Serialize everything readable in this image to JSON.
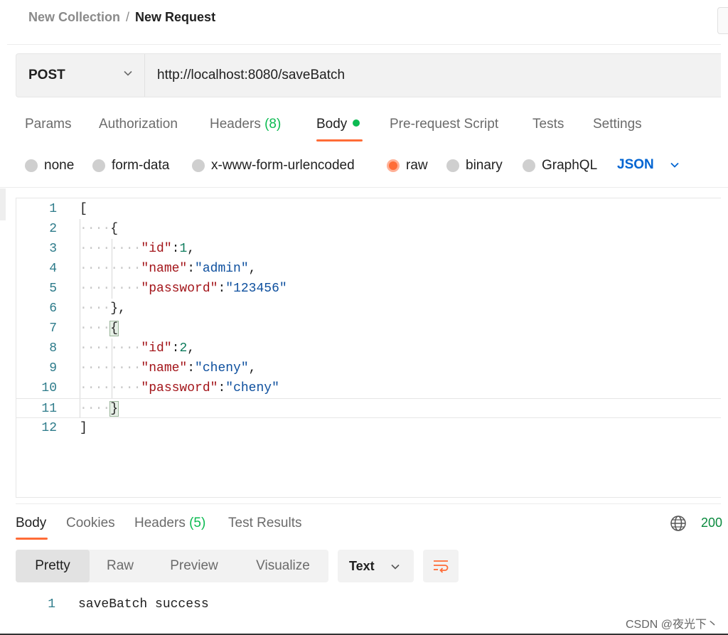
{
  "breadcrumb": {
    "collection": "New Collection",
    "separator": "/",
    "request": "New Request"
  },
  "request": {
    "method": "POST",
    "url": "http://localhost:8080/saveBatch"
  },
  "request_tabs": {
    "params": "Params",
    "authorization": "Authorization",
    "headers": "Headers",
    "headers_count": "(8)",
    "body": "Body",
    "pre_request": "Pre-request Script",
    "tests": "Tests",
    "settings": "Settings"
  },
  "body_types": {
    "none": "none",
    "form_data": "form-data",
    "urlencoded": "x-www-form-urlencoded",
    "raw": "raw",
    "binary": "binary",
    "graphql": "GraphQL",
    "language": "JSON",
    "selected": "raw"
  },
  "editor": {
    "line_numbers": [
      "1",
      "2",
      "3",
      "4",
      "5",
      "6",
      "7",
      "8",
      "9",
      "10",
      "11",
      "12"
    ],
    "records": [
      {
        "id_key": "\"id\"",
        "id_val": "1",
        "name_key": "\"name\"",
        "name_val": "\"admin\"",
        "pw_key": "\"password\"",
        "pw_val": "\"123456\""
      },
      {
        "id_key": "\"id\"",
        "id_val": "2",
        "name_key": "\"name\"",
        "name_val": "\"cheny\"",
        "pw_key": "\"password\"",
        "pw_val": "\"cheny\""
      }
    ]
  },
  "response_tabs": {
    "body": "Body",
    "cookies": "Cookies",
    "headers": "Headers",
    "headers_count": "(5)",
    "test_results": "Test Results",
    "status": "200"
  },
  "response_view": {
    "pretty": "Pretty",
    "raw": "Raw",
    "preview": "Preview",
    "visualize": "Visualize",
    "format": "Text"
  },
  "response_body": {
    "line_number": "1",
    "text": "saveBatch success"
  },
  "watermark": "CSDN @夜光下丶",
  "colors": {
    "accent": "#ff6c37",
    "json_blue": "#0265d2",
    "success_green": "#0cbb52"
  }
}
